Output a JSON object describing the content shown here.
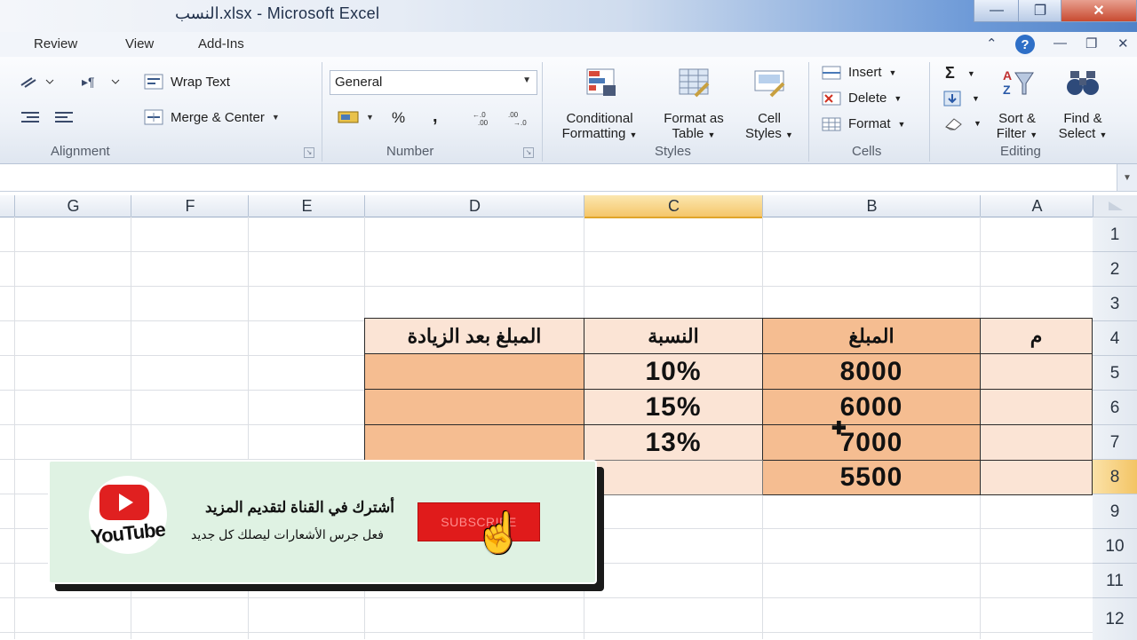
{
  "window": {
    "title": "النسب.xlsx  -  Microsoft Excel",
    "minimize": "—",
    "restore": "❐",
    "close": "✕"
  },
  "ribbon_tabs": [
    "Review",
    "View",
    "Add-Ins"
  ],
  "ribbon_right": {
    "up": "⌃",
    "help": "?",
    "min": "—",
    "restore": "❐",
    "close": "✕"
  },
  "alignment": {
    "wrap_text": "Wrap Text",
    "merge_center": "Merge & Center",
    "label": "Alignment"
  },
  "number": {
    "format": "General",
    "percent": "%",
    "comma": ",",
    "label": "Number"
  },
  "styles": {
    "conditional": [
      "Conditional",
      "Formatting"
    ],
    "format_table": [
      "Format as",
      "Table"
    ],
    "cell_styles": [
      "Cell",
      "Styles"
    ],
    "label": "Styles"
  },
  "cells": {
    "insert": "Insert",
    "delete": "Delete",
    "format": "Format",
    "label": "Cells"
  },
  "editing": {
    "sigma": "Σ",
    "sort": [
      "Sort &",
      "Filter"
    ],
    "find": [
      "Find &",
      "Select"
    ],
    "label": "Editing"
  },
  "columns": [
    "G",
    "F",
    "E",
    "D",
    "C",
    "B",
    "A"
  ],
  "rows": [
    "1",
    "2",
    "3",
    "4",
    "5",
    "6",
    "7",
    "8",
    "9",
    "10",
    "11",
    "12"
  ],
  "table": {
    "headers": {
      "m": "م",
      "amount": "المبلغ",
      "ratio": "النسبة",
      "after": "المبلغ بعد الزيادة"
    },
    "amounts": [
      "8000",
      "6000",
      "7000",
      "5500"
    ],
    "ratios": [
      "10%",
      "15%",
      "13%",
      ""
    ]
  },
  "promo": {
    "brand": "YouTube",
    "title": "أشترك في القناة لتقديم المزيد",
    "subtitle": "فعل جرس الأشعارات ليصلك كل جديد",
    "button": "SUBSCRIBE"
  },
  "colors": {
    "table_dark": "#f5bd91",
    "table_light": "#fbe4d5",
    "selected_header": "#f5c66a",
    "subscribe_red": "#e01b1b"
  }
}
